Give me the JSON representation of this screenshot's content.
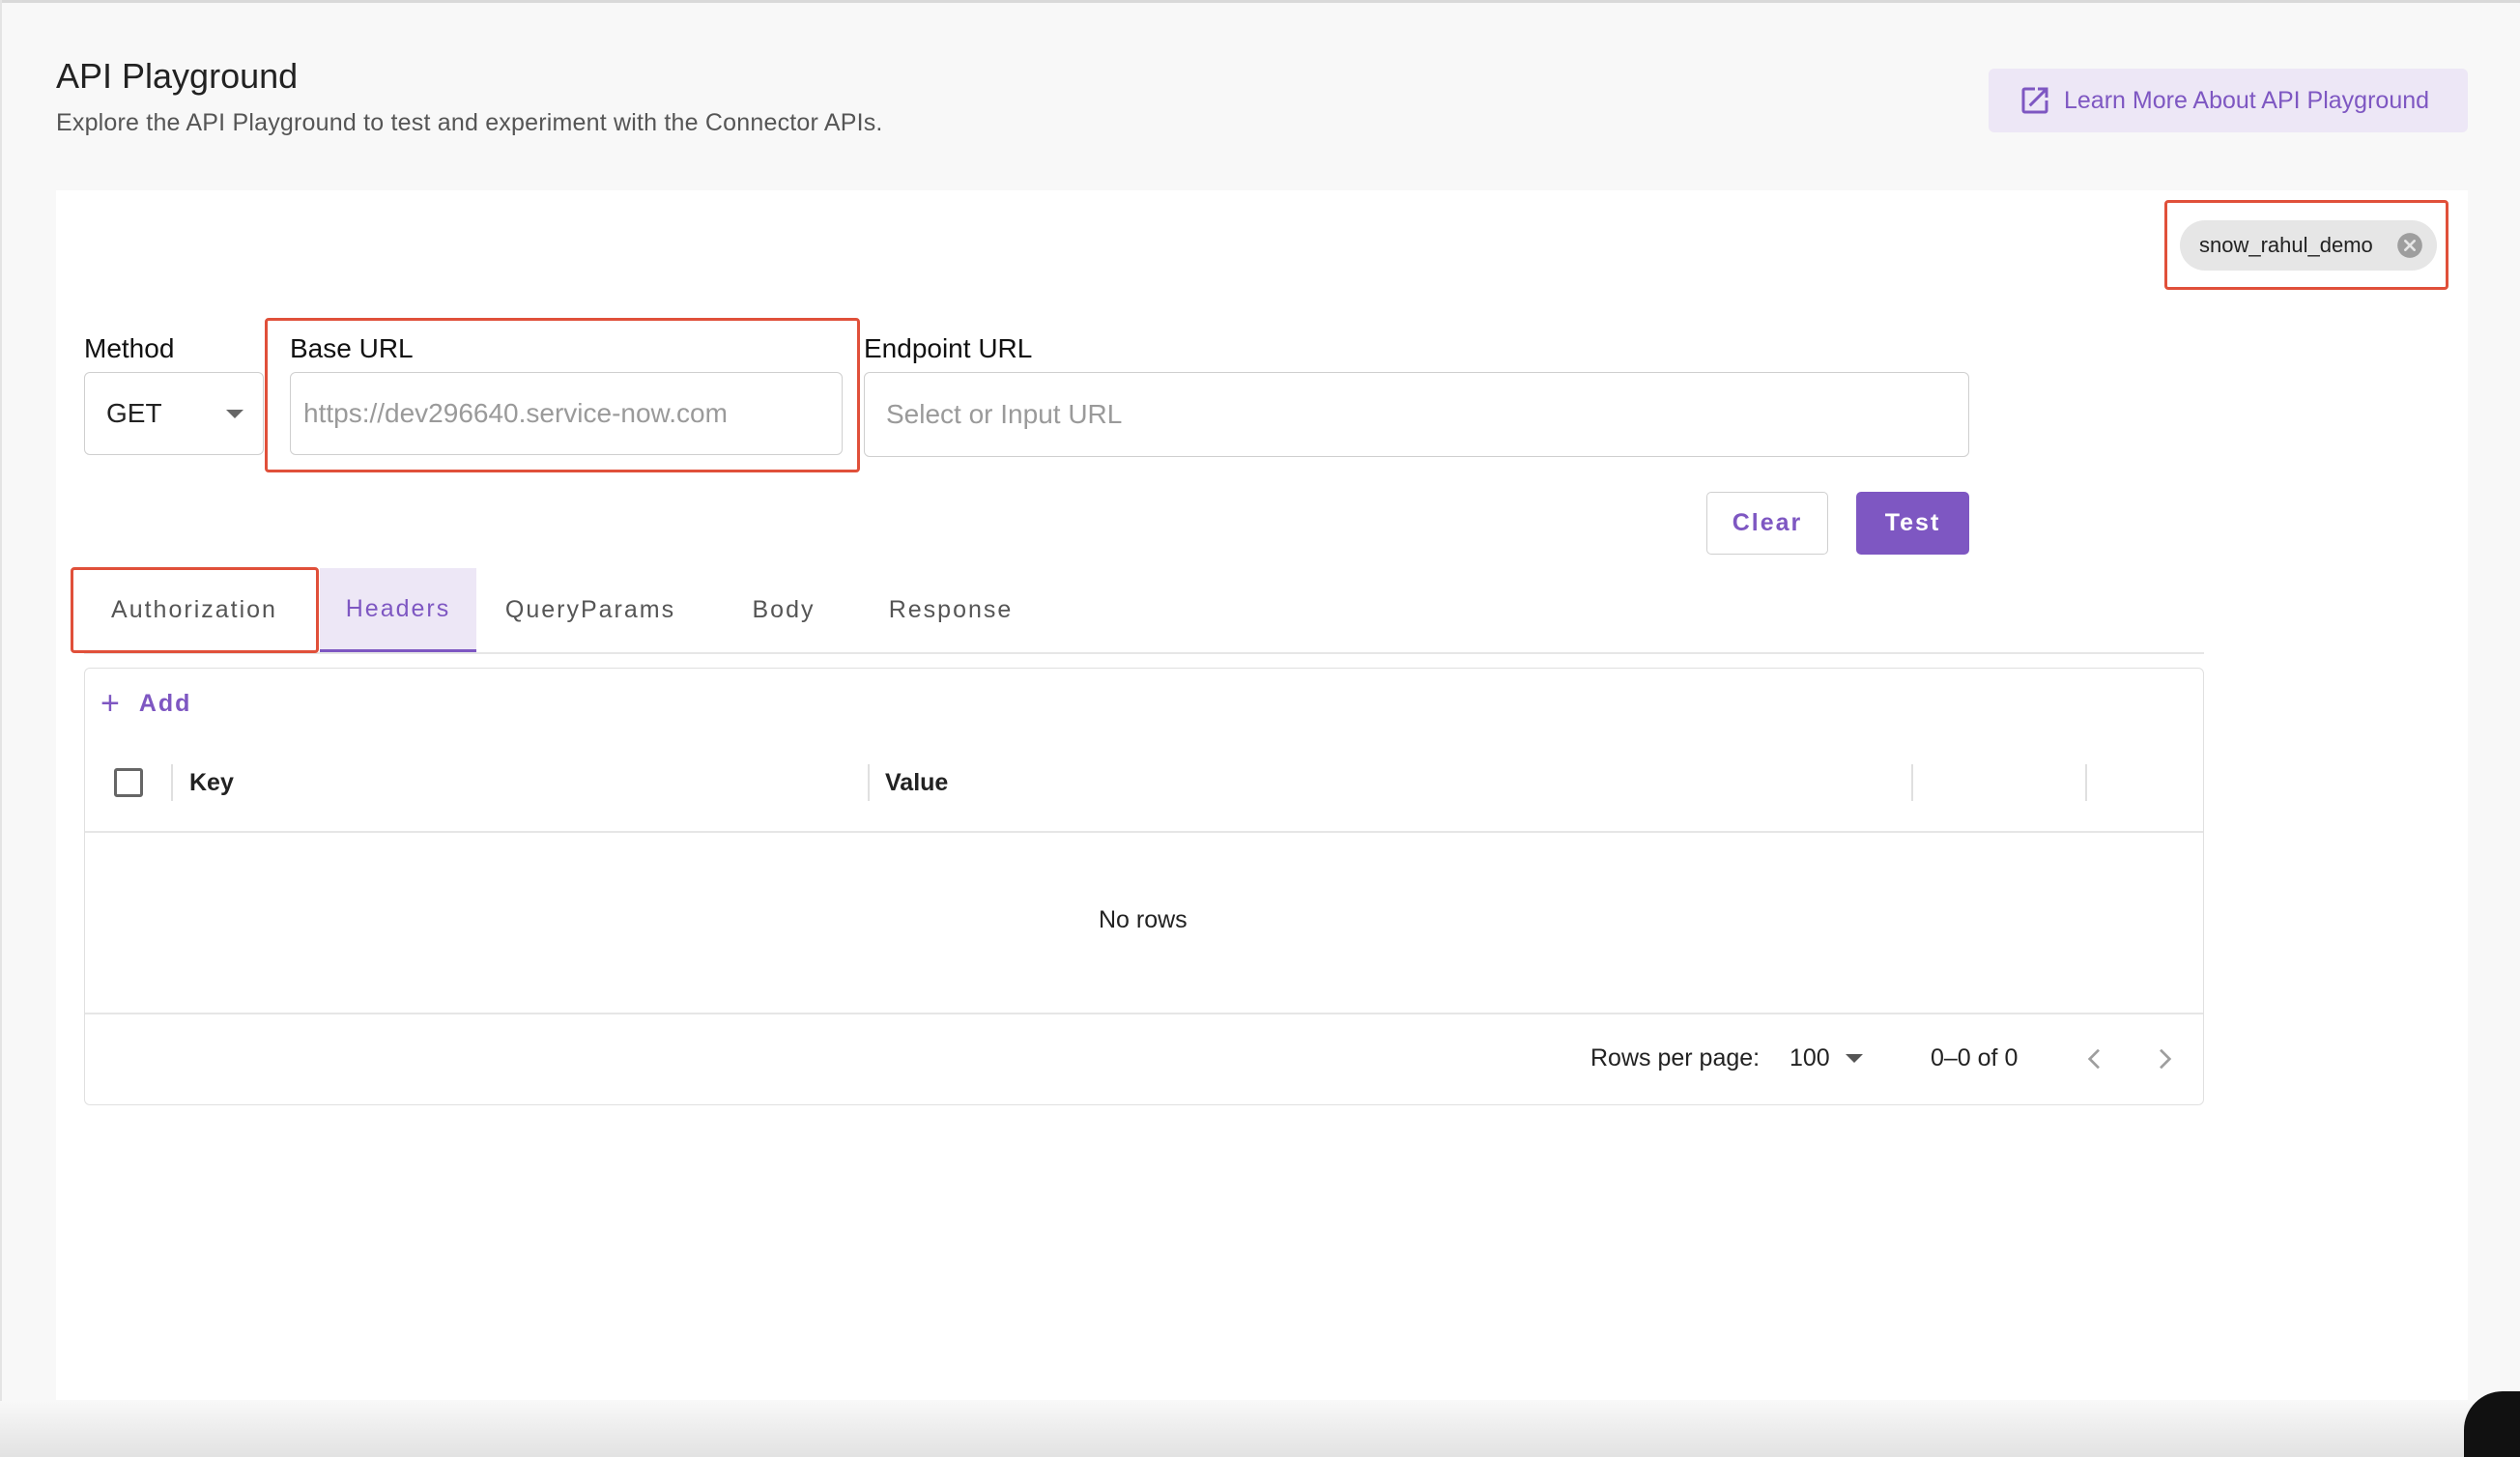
{
  "header": {
    "title": "API Playground",
    "subtitle": "Explore the API Playground to test and experiment with the Connector APIs.",
    "learn_more_label": "Learn More About API Playground",
    "learn_more_icon": "open-in-new-icon"
  },
  "connection_chip": {
    "label": "snow_rahul_demo",
    "close_icon": "cancel-circle-icon"
  },
  "request": {
    "method_label": "Method",
    "method_value": "GET",
    "base_url_label": "Base URL",
    "base_url_placeholder": "https://dev296640.service-now.com",
    "endpoint_label": "Endpoint URL",
    "endpoint_placeholder": "Select or Input URL"
  },
  "actions": {
    "clear_label": "Clear",
    "test_label": "Test"
  },
  "tabs": [
    {
      "label": "Authorization",
      "active": false
    },
    {
      "label": "Headers",
      "active": true
    },
    {
      "label": "QueryParams",
      "active": false
    },
    {
      "label": "Body",
      "active": false
    },
    {
      "label": "Response",
      "active": false
    }
  ],
  "grid": {
    "add_label": "Add",
    "columns": [
      "Key",
      "Value"
    ],
    "empty_text": "No rows",
    "rows_per_page_label": "Rows per page:",
    "rows_per_page_value": "100",
    "pagination_text": "0–0 of 0"
  },
  "colors": {
    "accent": "#7e57c2",
    "accent_light": "#ede7f6",
    "highlight_box": "#e0503a"
  }
}
